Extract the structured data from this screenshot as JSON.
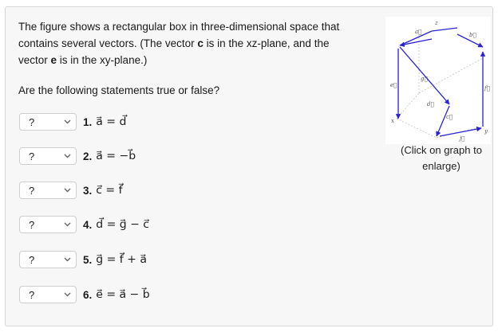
{
  "question": {
    "line1": "The figure shows a rectangular box in three-dimensional space that",
    "line2_pre": "contains several vectors. (The vector ",
    "line2_c": "c",
    "line2_post": " is in the xz-plane, and the",
    "line3_pre": "vector ",
    "line3_e": "e",
    "line3_post": " is in the xy-plane.)",
    "prompt": "Are the following statements true or false?"
  },
  "statements": [
    {
      "select_value": "?",
      "number": "1.",
      "expr": "a⃗ = d⃗"
    },
    {
      "select_value": "?",
      "number": "2.",
      "expr": "a⃗ = −b⃗"
    },
    {
      "select_value": "?",
      "number": "3.",
      "expr": "c⃗ = f⃗"
    },
    {
      "select_value": "?",
      "number": "4.",
      "expr": "d⃗ = g⃗ − c⃗"
    },
    {
      "select_value": "?",
      "number": "5.",
      "expr": "g⃗ = f⃗ + a⃗"
    },
    {
      "select_value": "?",
      "number": "6.",
      "expr": "e⃗ = a⃗ − b⃗"
    }
  ],
  "figure": {
    "caption": "(Click on graph to enlarge)",
    "labels": {
      "a": "a⃗",
      "b": "b⃗",
      "c": "c⃗",
      "d": "d⃗",
      "e": "e⃗",
      "f": "f⃗",
      "g": "g⃗",
      "j": "j⃗",
      "x": "x",
      "y": "y",
      "z": "z"
    },
    "vector_color": "#2a22d6"
  },
  "colors": {
    "panel_bg": "#f7f7f7",
    "panel_border": "#d6d6d6"
  }
}
